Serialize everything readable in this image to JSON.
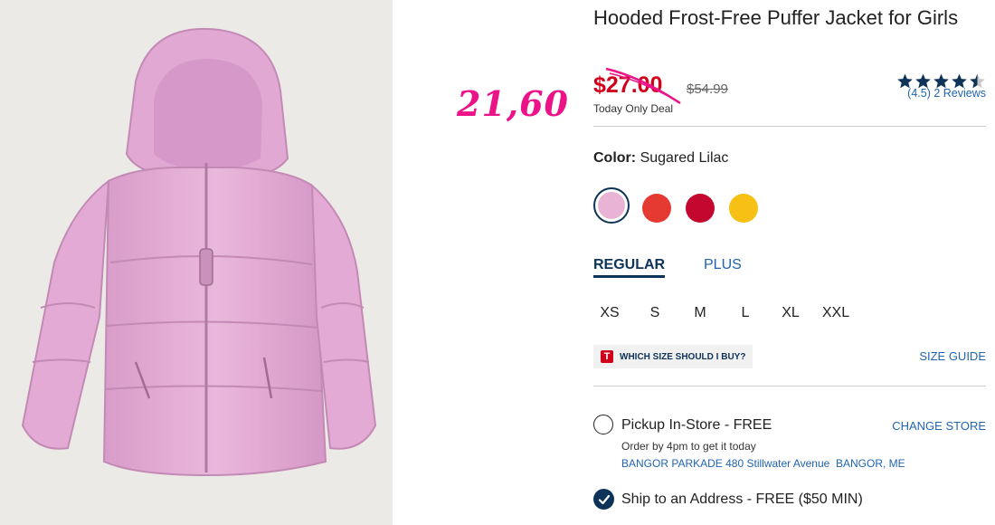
{
  "product": {
    "title": "Hooded Frost-Free Puffer Jacket for Girls",
    "sale_price": "$27.00",
    "original_price": "$54.99",
    "deal_label": "Today Only Deal",
    "handwritten_note": "21,60",
    "rating": {
      "value": 4.5,
      "max": 5,
      "text": "(4.5) 2 Reviews"
    }
  },
  "color": {
    "label": "Color:",
    "selected": "Sugared Lilac",
    "swatches": [
      {
        "name": "Sugared Lilac",
        "hex": "#e9b3d6",
        "selected": true
      },
      {
        "name": "Red",
        "hex": "#e53a32",
        "selected": false
      },
      {
        "name": "Crimson",
        "hex": "#c4072f",
        "selected": false
      },
      {
        "name": "Yellow",
        "hex": "#f6c114",
        "selected": false
      }
    ]
  },
  "fit_tabs": {
    "regular": "REGULAR",
    "plus": "PLUS",
    "active": "REGULAR"
  },
  "sizes": [
    "XS",
    "S",
    "M",
    "L",
    "XL",
    "XXL"
  ],
  "size_help": {
    "logo_letter": "T",
    "which_size": "WHICH SIZE SHOULD I BUY?",
    "size_guide": "SIZE GUIDE"
  },
  "fulfillment": {
    "pickup_label": "Pickup In-Store - FREE",
    "change_store": "CHANGE STORE",
    "order_by": "Order by 4pm to get it today",
    "store_address": "BANGOR PARKADE 480 Stillwater Avenue  BANGOR, ME",
    "ship_label": "Ship to an Address - FREE ($50 MIN)",
    "selected": "ship"
  },
  "colors": {
    "accent_navy": "#0e3358",
    "link_blue": "#2065b0",
    "sale_red": "#d0021b",
    "handwritten_pink": "#ec1288"
  }
}
